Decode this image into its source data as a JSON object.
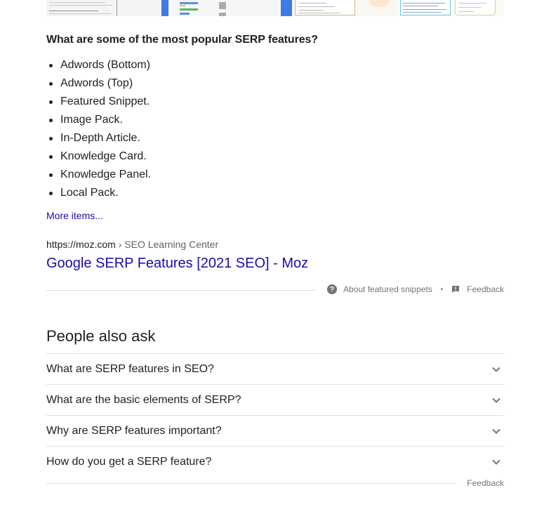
{
  "thumbnails": [
    {
      "name": "thumbnail-1",
      "alt": "SERP features diagram screenshot"
    },
    {
      "name": "thumbnail-2",
      "alt": "Search results layout screenshot"
    },
    {
      "name": "thumbnail-3",
      "alt": "People also ask box screenshot"
    },
    {
      "name": "thumbnail-4",
      "alt": "Illustration screenshot"
    },
    {
      "name": "thumbnail-5",
      "alt": "Featured snippet screenshot"
    },
    {
      "name": "thumbnail-6",
      "alt": "Search result card screenshot"
    }
  ],
  "snippet": {
    "question": "What are some of the most popular SERP features?",
    "items": [
      "Adwords (Bottom)",
      "Adwords (Top)",
      "Featured Snippet.",
      "Image Pack.",
      "In-Depth Article.",
      "Knowledge Card.",
      "Knowledge Panel.",
      "Local Pack."
    ],
    "more_items": "More items...",
    "cite_url": "https://moz.com",
    "cite_separator": " › ",
    "cite_crumb": "SEO Learning Center",
    "result_title": "Google SERP Features [2021 SEO] - Moz",
    "about_label": "About featured snippets",
    "separator_dot": "•",
    "feedback_label": "Feedback"
  },
  "people_also_ask": {
    "title": "People also ask",
    "questions": [
      "What are SERP features in SEO?",
      "What are the basic elements of SERP?",
      "Why are SERP features important?",
      "How do you get a SERP feature?"
    ],
    "feedback_label": "Feedback"
  },
  "colors": {
    "link": "#1a0dab",
    "text": "#202124",
    "secondary": "#70757a",
    "divider": "#dadce0"
  }
}
